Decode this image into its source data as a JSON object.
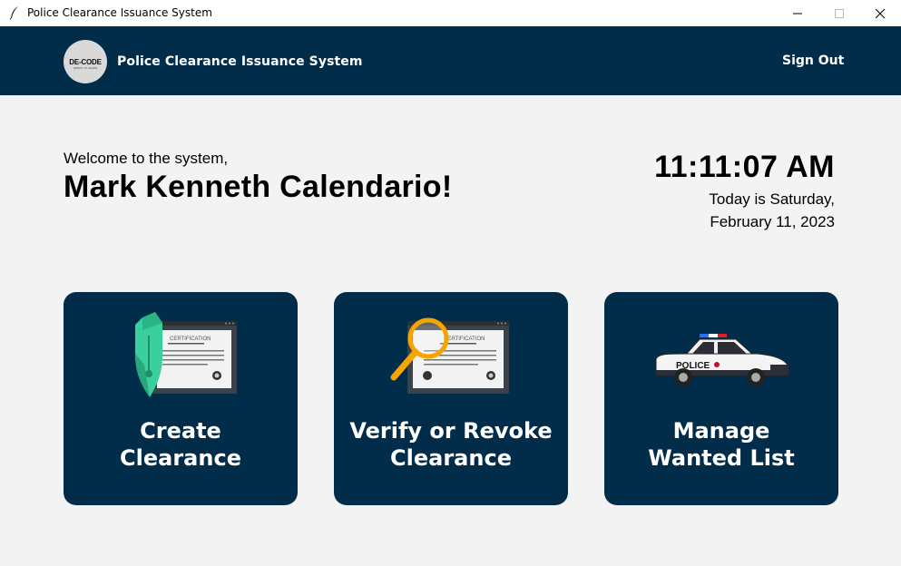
{
  "window": {
    "title": "Police Clearance Issuance System",
    "minimize_glyph": "—",
    "maximize_glyph": "☐",
    "close_glyph": "✕"
  },
  "header": {
    "logo_text": "DE-CODE",
    "logo_subtext": "DEBUG TO SHAPE",
    "title": "Police Clearance Issuance System",
    "signout_label": "Sign Out",
    "bg_color": "#022d4a"
  },
  "main": {
    "welcome_text": "Welcome to the system,",
    "user_name": "Mark Kenneth Calendario!",
    "time": "11:11:07 AM",
    "date_line1": "Today is Saturday,",
    "date_line2": "February 11, 2023"
  },
  "cards": [
    {
      "line1": "Create",
      "line2": "Clearance",
      "icon": "pen-certificate-icon",
      "cert_text": "CERTIFICATION"
    },
    {
      "line1": "Verify or Revoke",
      "line2": "Clearance",
      "icon": "magnifier-certificate-icon",
      "cert_text": "CERTIFICATION"
    },
    {
      "line1": "Manage",
      "line2": "Wanted List",
      "icon": "police-car-icon",
      "car_text": "POLICE"
    }
  ]
}
